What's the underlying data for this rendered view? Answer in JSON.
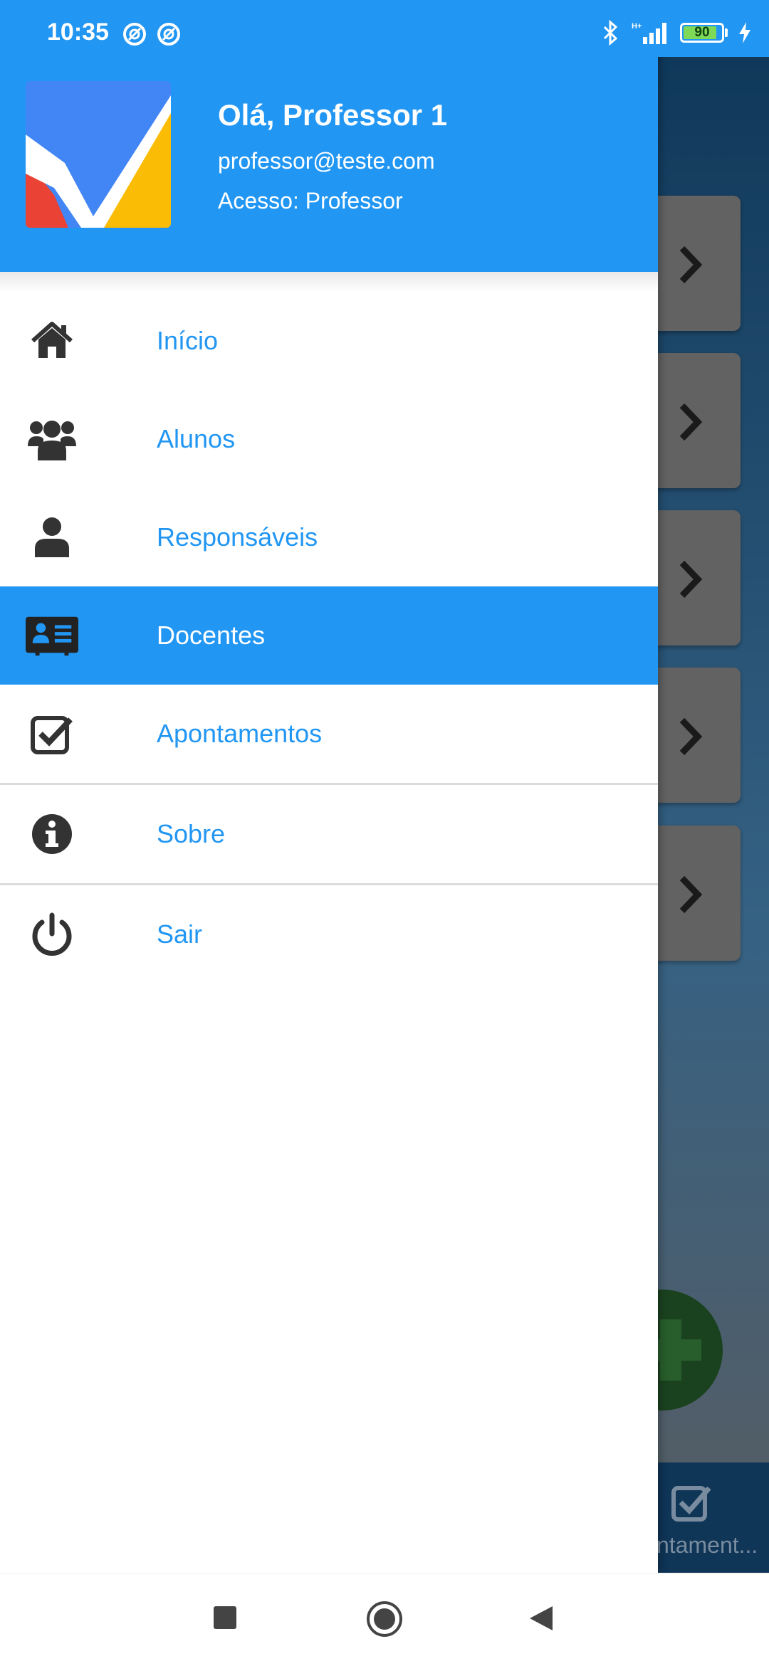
{
  "status_bar": {
    "time": "10:35",
    "battery_level": "90",
    "battery_fraction": 0.9,
    "icons": [
      "notification-icon",
      "notification-icon",
      "bluetooth-icon",
      "signal-icon",
      "battery-icon",
      "charging-icon"
    ]
  },
  "drawer": {
    "header": {
      "greeting": "Olá, Professor 1",
      "email": "professor@teste.com",
      "access": "Acesso: Professor"
    },
    "items": [
      {
        "label": "Início",
        "icon": "home-icon",
        "active": false
      },
      {
        "label": "Alunos",
        "icon": "users-icon",
        "active": false
      },
      {
        "label": "Responsáveis",
        "icon": "user-icon",
        "active": false
      },
      {
        "label": "Docentes",
        "icon": "id-card-icon",
        "active": true
      },
      {
        "label": "Apontamentos",
        "icon": "check-square-icon",
        "active": false
      },
      {
        "label": "Sobre",
        "icon": "info-icon",
        "active": false
      },
      {
        "label": "Sair",
        "icon": "power-icon",
        "active": false
      }
    ]
  },
  "background": {
    "bottom_nav_label": "ntament..."
  },
  "colors": {
    "primary": "#2196f3",
    "icon_dark": "#333333",
    "logo_blue": "#4285f4",
    "logo_red": "#ea4335",
    "logo_yellow": "#fbbc05"
  }
}
